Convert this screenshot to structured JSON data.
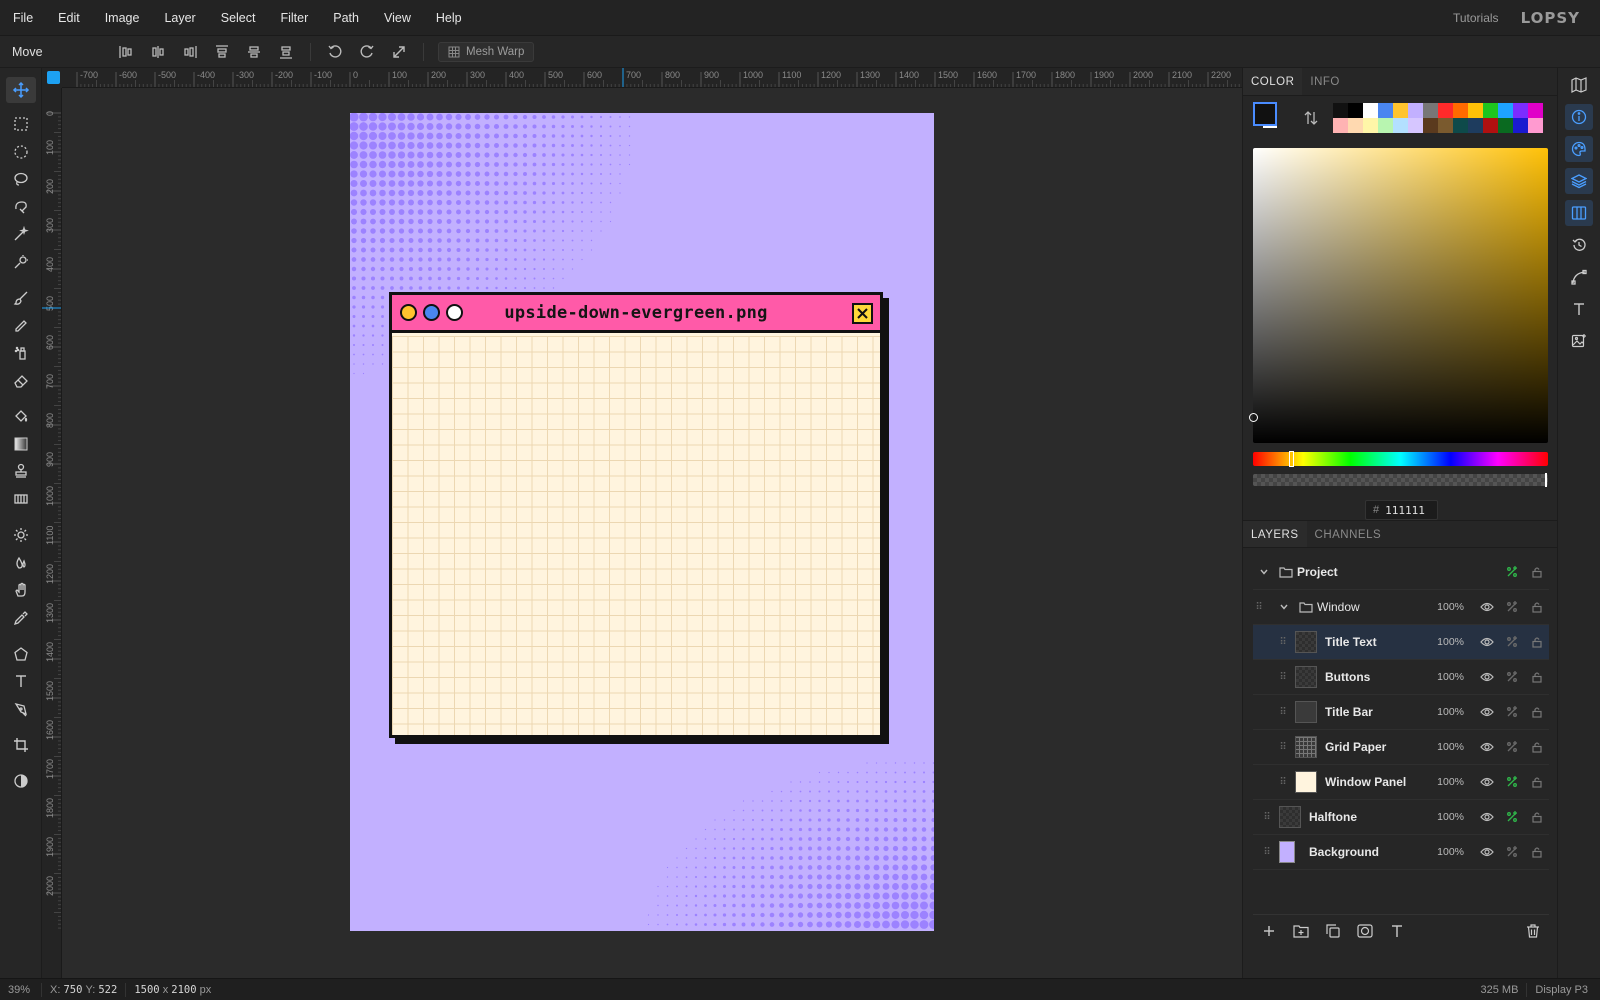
{
  "menubar": {
    "items": [
      "File",
      "Edit",
      "Image",
      "Layer",
      "Select",
      "Filter",
      "Path",
      "View",
      "Help"
    ],
    "tutorials": "Tutorials",
    "logo": "LOPSY"
  },
  "options": {
    "tool_name": "Move",
    "mesh_warp": "Mesh Warp"
  },
  "rulers": {
    "h_ticks": [
      "-700",
      "-600",
      "-500",
      "-400",
      "-300",
      "-200",
      "-100",
      "0",
      "100",
      "200",
      "300",
      "400",
      "500",
      "600",
      "700",
      "800",
      "900",
      "1000",
      "1100",
      "1200",
      "1300",
      "1400",
      "1500",
      "1600",
      "1700",
      "1800",
      "1900",
      "2000",
      "2100",
      "2200"
    ],
    "v_ticks": [
      "0",
      "100",
      "200",
      "300",
      "400",
      "500",
      "600",
      "700",
      "800",
      "900",
      "1000",
      "1100",
      "1200",
      "1300",
      "1400",
      "1500",
      "1600",
      "1700",
      "1800",
      "1900",
      "2000"
    ]
  },
  "document": {
    "window_title": "upside-down-evergreen.png",
    "colors": {
      "background": "#c2b0ff",
      "halftone": "#9c82ff",
      "title_bar": "#ff5aa8",
      "panel": "#fff4de",
      "close": "#ffd83a",
      "dot1": "#ffc42e",
      "dot2": "#4a86f0",
      "dot3": "#ffffff"
    }
  },
  "color_panel": {
    "tabs": [
      "COLOR",
      "INFO"
    ],
    "hex_label": "#",
    "hex_value": "111111",
    "swatches": [
      "#111111",
      "#000000",
      "#ffffff",
      "#4a86f0",
      "#ffc42e",
      "#c2b0ff",
      "#777777",
      "#ff2a2a",
      "#ff6a00",
      "#ffc107",
      "#1ec51e",
      "#1ea3ff",
      "#7b2dff",
      "#e000c8",
      "#ffb3b3",
      "#ffd9b0",
      "#fff6a8",
      "#b8f5b0",
      "#b3e0ff",
      "#d6c6ff",
      "#5a3a1e",
      "#7a5a2e",
      "#0e4a4a",
      "#1e3c5e",
      "#b01010",
      "#0a6a20",
      "#1a1ad0",
      "#ff9ad0"
    ]
  },
  "layers_panel": {
    "tabs": [
      "LAYERS",
      "CHANNELS"
    ],
    "rows": [
      {
        "name": "Project",
        "opacity": ""
      },
      {
        "name": "Window",
        "opacity": "100%"
      },
      {
        "name": "Title Text",
        "opacity": "100%"
      },
      {
        "name": "Buttons",
        "opacity": "100%"
      },
      {
        "name": "Title Bar",
        "opacity": "100%"
      },
      {
        "name": "Grid Paper",
        "opacity": "100%"
      },
      {
        "name": "Window Panel",
        "opacity": "100%"
      },
      {
        "name": "Halftone",
        "opacity": "100%"
      },
      {
        "name": "Background",
        "opacity": "100%"
      }
    ]
  },
  "status": {
    "zoom": "39%",
    "x_label": "X:",
    "x_value": "750",
    "y_label": "Y:",
    "y_value": "522",
    "w": "1500",
    "times": "x",
    "h": "2100",
    "unit": "px",
    "memory": "325 MB",
    "profile": "Display P3"
  }
}
